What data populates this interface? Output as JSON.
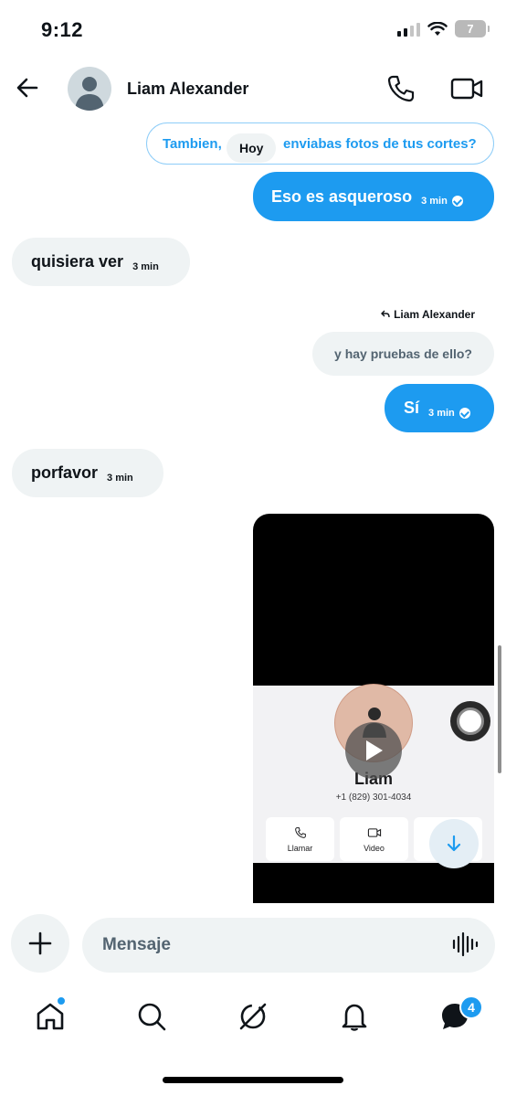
{
  "status_bar": {
    "time": "9:12",
    "battery": "7"
  },
  "header": {
    "contact_name": "Liam Alexander"
  },
  "messages": {
    "top_reply_part1": "Tambien,",
    "top_reply_part2": "enviabas fotos de tus cortes?",
    "date_chip": "Hoy",
    "msg1": {
      "text": "Eso es asqueroso",
      "time": "3 min"
    },
    "msg2": {
      "text": "quisiera ver",
      "time": "3 min"
    },
    "reply_to": "Liam Alexander",
    "quoted": "y hay pruebas de ello?",
    "msg3": {
      "text": "Sí",
      "time": "3 min"
    },
    "msg4": {
      "text": "porfavor",
      "time": "3 min"
    }
  },
  "video": {
    "contact_name": "Liam",
    "phone": "+1 (829) 301-4034",
    "actions": [
      "Llamar",
      "Video"
    ]
  },
  "composer": {
    "placeholder": "Mensaje"
  },
  "tab_bar": {
    "items": [
      "home-icon",
      "search-icon",
      "grok-icon",
      "bell-icon",
      "messages-icon"
    ],
    "messages_badge": "4"
  },
  "colors": {
    "accent": "#1d9bf0",
    "bubble_in": "#eff3f4",
    "text": "#0f1419",
    "muted": "#536471"
  }
}
